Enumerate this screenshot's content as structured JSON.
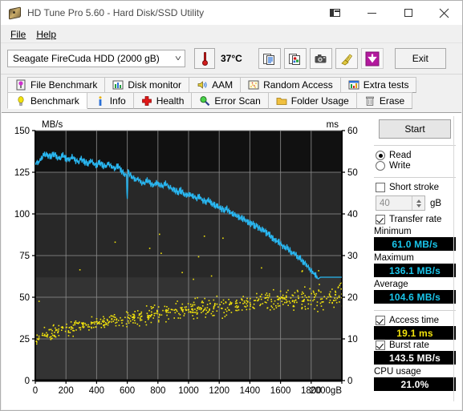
{
  "window": {
    "title": "HD Tune Pro 5.60 - Hard Disk/SSD Utility",
    "app_icon": "hard-disk-icon",
    "buttons": {
      "restore_down": "restore-down-icon",
      "minimize": "minimize-icon",
      "maximize": "maximize-icon",
      "close": "close-icon"
    }
  },
  "menu": {
    "items": [
      {
        "label": "File",
        "mnemonic": "F"
      },
      {
        "label": "Help",
        "mnemonic": "H"
      }
    ]
  },
  "toolbar": {
    "drive_selected": "Seagate FireCuda HDD (2000 gB)",
    "drive_options": [
      "Seagate FireCuda HDD (2000 gB)"
    ],
    "temperature": "37°C",
    "temp_icon": "thermometer-icon",
    "buttons": [
      {
        "name": "copy-text-icon",
        "tooltip": "Copy"
      },
      {
        "name": "copy-image-icon",
        "tooltip": "Copy screenshot"
      },
      {
        "name": "camera-icon",
        "tooltip": "Screenshot"
      },
      {
        "name": "broom-icon",
        "tooltip": "Clear"
      },
      {
        "name": "download-arrow-icon",
        "tooltip": "Download"
      }
    ],
    "exit_label": "Exit"
  },
  "tabs": {
    "row1": [
      {
        "label": "File Benchmark",
        "icon": "file-benchmark-icon",
        "active": false
      },
      {
        "label": "Disk monitor",
        "icon": "bar-chart-icon",
        "active": false
      },
      {
        "label": "AAM",
        "icon": "speaker-icon",
        "active": false
      },
      {
        "label": "Random Access",
        "icon": "random-access-icon",
        "active": false
      },
      {
        "label": "Extra tests",
        "icon": "extra-tests-icon",
        "active": false
      }
    ],
    "row2": [
      {
        "label": "Benchmark",
        "icon": "lightbulb-icon",
        "active": true
      },
      {
        "label": "Info",
        "icon": "info-icon",
        "active": false
      },
      {
        "label": "Health",
        "icon": "red-cross-icon",
        "active": false
      },
      {
        "label": "Error Scan",
        "icon": "magnifier-icon",
        "active": false
      },
      {
        "label": "Folder Usage",
        "icon": "folder-icon",
        "active": false
      },
      {
        "label": "Erase",
        "icon": "trash-icon",
        "active": false
      }
    ]
  },
  "panel": {
    "start_label": "Start",
    "mode": {
      "read_label": "Read",
      "write_label": "Write",
      "selected": "Read"
    },
    "short_stroke": {
      "label": "Short stroke",
      "checked": false,
      "value": "40",
      "unit": "gB"
    },
    "transfer_rate": {
      "label": "Transfer rate",
      "checked": true
    },
    "results": [
      {
        "label": "Minimum",
        "value": "61.0 MB/s",
        "color": "cyan"
      },
      {
        "label": "Maximum",
        "value": "136.1 MB/s",
        "color": "cyan"
      },
      {
        "label": "Average",
        "value": "104.6 MB/s",
        "color": "cyan"
      }
    ],
    "access_time": {
      "label": "Access time",
      "checked": true,
      "value": "19.1 ms",
      "color": "yellow"
    },
    "burst_rate": {
      "label": "Burst rate",
      "checked": true,
      "value": "143.5 MB/s",
      "color": "white"
    },
    "cpu_usage": {
      "label": "CPU usage",
      "value": "21.0%",
      "color": "white"
    }
  },
  "chart_data": {
    "type": "line",
    "title": "",
    "xlabel": "gB",
    "ylabel": "MB/s",
    "y2label": "ms",
    "xlim": [
      0,
      2000
    ],
    "ylim": [
      0,
      150
    ],
    "y2lim": [
      0,
      60
    ],
    "xticks": [
      0,
      200,
      400,
      600,
      800,
      1000,
      1200,
      1400,
      1600,
      1800,
      2000
    ],
    "xticklabels": [
      "0",
      "200",
      "400",
      "600",
      "800",
      "1000",
      "1200",
      "1400",
      "1600",
      "1800",
      "2000gB"
    ],
    "yticks": [
      0,
      25,
      50,
      75,
      100,
      125,
      150
    ],
    "y2ticks": [
      0,
      10,
      20,
      30,
      40,
      50,
      60
    ],
    "grid": true,
    "plot_bg": "#111111",
    "plot_bg_lower": "#333333",
    "grid_color": "#888888",
    "series": [
      {
        "name": "Transfer rate",
        "type": "line",
        "color": "#29b6f0",
        "axis": "left",
        "units": "MB/s",
        "x": [
          0,
          20,
          40,
          60,
          80,
          100,
          120,
          140,
          160,
          180,
          200,
          220,
          240,
          260,
          280,
          300,
          320,
          340,
          360,
          380,
          400,
          420,
          440,
          460,
          480,
          500,
          520,
          540,
          560,
          580,
          595,
          600,
          605,
          610,
          630,
          650,
          670,
          690,
          710,
          730,
          750,
          770,
          790,
          810,
          830,
          850,
          870,
          890,
          910,
          930,
          950,
          970,
          990,
          1010,
          1030,
          1050,
          1070,
          1090,
          1110,
          1130,
          1150,
          1170,
          1190,
          1210,
          1230,
          1250,
          1270,
          1290,
          1310,
          1330,
          1350,
          1370,
          1390,
          1410,
          1430,
          1450,
          1470,
          1490,
          1510,
          1530,
          1550,
          1570,
          1590,
          1610,
          1630,
          1650,
          1670,
          1690,
          1710,
          1730,
          1750,
          1770,
          1790,
          1810,
          1830,
          1845,
          1860,
          1900,
          1950,
          2000
        ],
        "y": [
          130,
          131,
          133,
          136,
          135,
          134,
          136,
          134,
          133,
          135,
          133,
          132,
          134,
          132,
          131,
          133,
          131,
          130,
          132,
          130,
          129,
          131,
          129,
          128,
          130,
          128,
          127,
          129,
          126,
          124,
          122,
          108,
          126,
          125,
          122,
          120,
          121,
          119,
          118,
          120,
          118,
          117,
          119,
          117,
          116,
          118,
          116,
          115,
          114,
          113,
          114,
          112,
          111,
          112,
          110,
          109,
          110,
          108,
          107,
          108,
          106,
          105,
          104,
          103,
          102,
          103,
          101,
          100,
          99,
          98,
          97,
          96,
          95,
          94,
          93,
          92,
          91,
          90,
          88,
          87,
          85,
          84,
          83,
          81,
          80,
          79,
          77,
          76,
          74,
          73,
          71,
          69,
          67,
          65,
          63,
          61,
          62,
          62,
          62,
          62
        ]
      },
      {
        "name": "Access time",
        "type": "scatter",
        "color": "#f2e30c",
        "axis": "right",
        "units": "ms",
        "point_count": 640,
        "description": "Yellow scatter of random-access latency samples rising from ~5-14 ms near gB 0 to ~14-28 ms near gB 2000, with sparse outliers up to ~38 ms",
        "trend_start_ms": 9.5,
        "trend_end_ms": 20.5,
        "spread_ms": 7.0
      }
    ]
  }
}
